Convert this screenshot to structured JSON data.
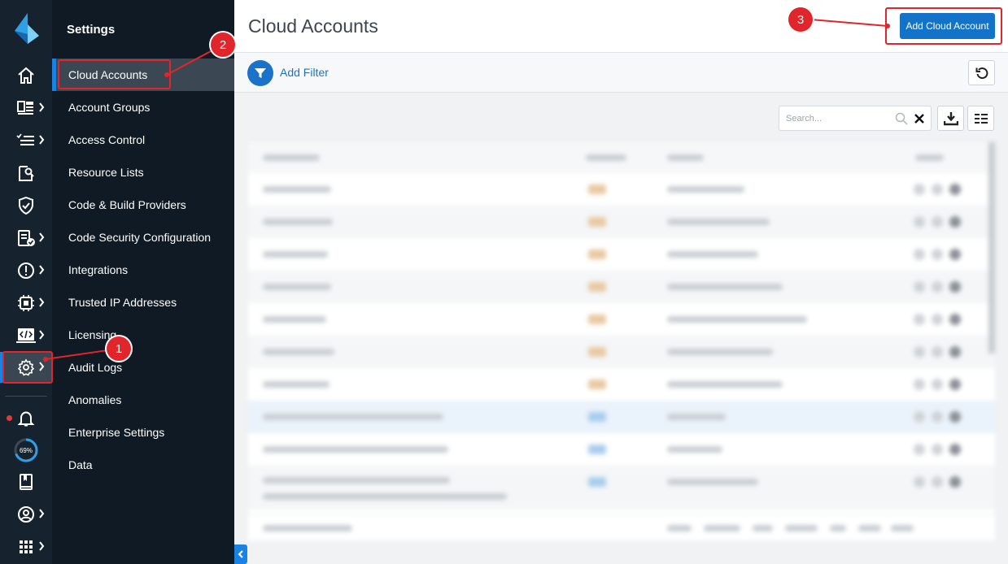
{
  "rail": {
    "items": [
      {
        "icon": "home-icon",
        "chevron": false
      },
      {
        "icon": "dashboard-icon",
        "chevron": true
      },
      {
        "icon": "list-check-icon",
        "chevron": true
      },
      {
        "icon": "investigate-icon",
        "chevron": false
      },
      {
        "icon": "shield-icon",
        "chevron": false
      },
      {
        "icon": "compliance-report-icon",
        "chevron": true
      },
      {
        "icon": "alert-icon",
        "chevron": true
      },
      {
        "icon": "cpu-icon",
        "chevron": true
      },
      {
        "icon": "code-icon",
        "chevron": true
      },
      {
        "icon": "gear-icon",
        "chevron": true,
        "active": true
      }
    ],
    "bottom": {
      "notifications": "bell-icon",
      "progress_label": "69%",
      "progress_value": 0.69,
      "book": "book-icon",
      "profile": "user-icon",
      "apps": "apps-grid-icon"
    }
  },
  "menu": {
    "title": "Settings",
    "items": [
      "Cloud Accounts",
      "Account Groups",
      "Access Control",
      "Resource Lists",
      "Code & Build Providers",
      "Code Security Configuration",
      "Integrations",
      "Trusted IP Addresses",
      "Licensing",
      "Audit Logs",
      "Anomalies",
      "Enterprise Settings",
      "Data"
    ],
    "active_index": 0
  },
  "main": {
    "title": "Cloud Accounts",
    "add_button": "Add Cloud Account",
    "filter_label": "Add Filter",
    "search_placeholder": "Search..."
  },
  "annotations": [
    "1",
    "2",
    "3"
  ],
  "colors": {
    "accent": "#1a82e2",
    "annotation": "#e0252b",
    "rail_bg": "#16232f",
    "menu_bg": "#0f1a24"
  }
}
